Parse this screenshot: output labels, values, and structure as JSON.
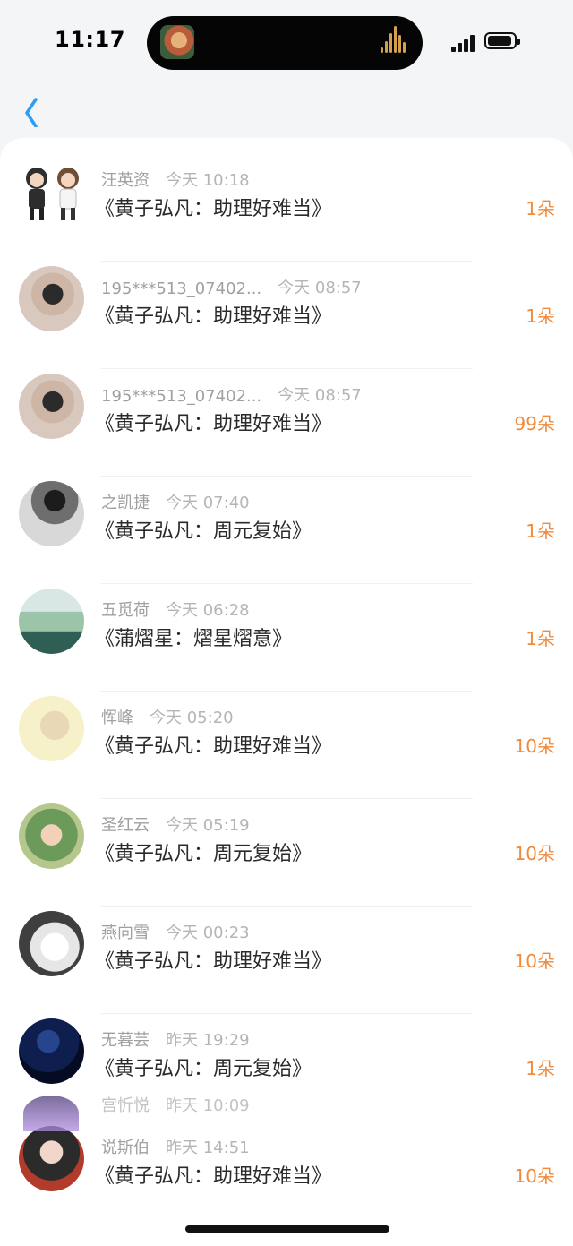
{
  "status_bar": {
    "time": "11:17"
  },
  "header": {
    "back_icon": "chevron-left"
  },
  "colors": {
    "accent": "#2d9cf3",
    "amount": "#f08a3c",
    "muted": "#a0a0a0",
    "background": "#f4f5f7"
  },
  "list": [
    {
      "name": "汪英资",
      "time": "今天 10:18",
      "title": "《黄子弘凡：助理好难当》",
      "amount": "1朵"
    },
    {
      "name": "195***513_07402...",
      "time": "今天 08:57",
      "title": "《黄子弘凡：助理好难当》",
      "amount": "1朵"
    },
    {
      "name": "195***513_07402...",
      "time": "今天 08:57",
      "title": "《黄子弘凡：助理好难当》",
      "amount": "99朵"
    },
    {
      "name": "之凯捷",
      "time": "今天 07:40",
      "title": "《黄子弘凡：周元复始》",
      "amount": "1朵"
    },
    {
      "name": "五觅荷",
      "time": "今天 06:28",
      "title": "《蒲熠星：熠星熠意》",
      "amount": "1朵"
    },
    {
      "name": "恽峰",
      "time": "今天 05:20",
      "title": "《黄子弘凡：助理好难当》",
      "amount": "10朵"
    },
    {
      "name": "圣红云",
      "time": "今天 05:19",
      "title": "《黄子弘凡：周元复始》",
      "amount": "10朵"
    },
    {
      "name": "燕向雪",
      "time": "今天 00:23",
      "title": "《黄子弘凡：助理好难当》",
      "amount": "10朵"
    },
    {
      "name": "无暮芸",
      "time": "昨天 19:29",
      "title": "《黄子弘凡：周元复始》",
      "amount": "1朵"
    },
    {
      "name": "说斯伯",
      "time": "昨天 14:51",
      "title": "《黄子弘凡：助理好难当》",
      "amount": "10朵"
    }
  ],
  "partial_row": {
    "name": "宫忻悦",
    "time": "昨天 10:09"
  }
}
